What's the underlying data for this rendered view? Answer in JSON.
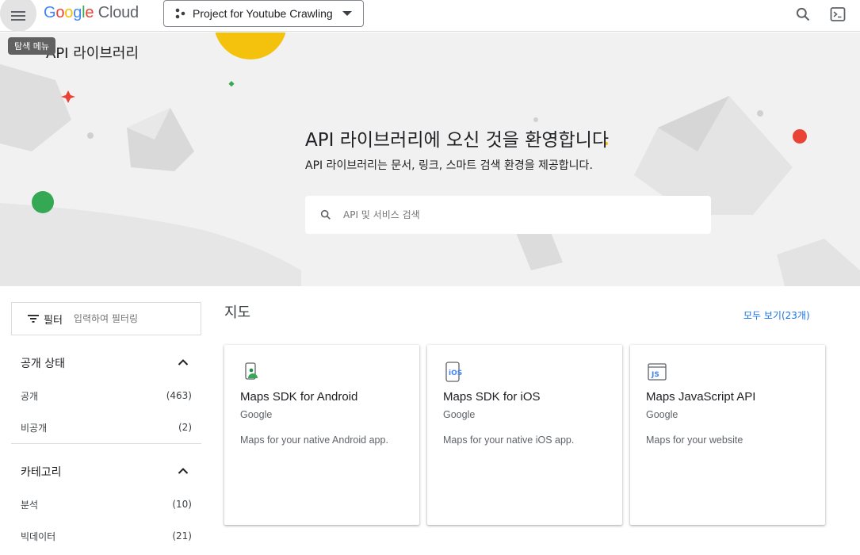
{
  "topbar": {
    "logo_parts": [
      "G",
      "o",
      "o",
      "g",
      "l",
      "e"
    ],
    "logo_suffix": "Cloud",
    "project_name": "Project for Youtube Crawling",
    "menu_tooltip": "탐색 메뉴",
    "page_title": "API 라이브러리"
  },
  "hero": {
    "heading": "API 라이브러리에 오신 것을 환영합니다",
    "subheading": "API 라이브러리는 문서, 링크, 스마트 검색 환경을 제공합니다.",
    "search_placeholder": "API 및 서비스 검색"
  },
  "sidebar": {
    "filter_label": "필터",
    "filter_placeholder": "입력하여 필터링",
    "sections": [
      {
        "title": "공개 상태",
        "items": [
          {
            "label": "공개",
            "count": "(463)"
          },
          {
            "label": "비공개",
            "count": "(2)"
          }
        ]
      },
      {
        "title": "카테고리",
        "items": [
          {
            "label": "분석",
            "count": "(10)"
          },
          {
            "label": "빅데이터",
            "count": "(21)"
          }
        ]
      }
    ]
  },
  "main": {
    "section_title": "지도",
    "see_all": "모두 보기(23개)",
    "cards": [
      {
        "icon": "android-maps-icon",
        "title": "Maps SDK for Android",
        "vendor": "Google",
        "description": "Maps for your native Android app."
      },
      {
        "icon": "ios-maps-icon",
        "title": "Maps SDK for iOS",
        "vendor": "Google",
        "description": "Maps for your native iOS app."
      },
      {
        "icon": "js-maps-icon",
        "title": "Maps JavaScript API",
        "vendor": "Google",
        "description": "Maps for your website"
      }
    ]
  },
  "colors": {
    "accent": "#1a73e8",
    "hero_bg": "#f1f1f1"
  }
}
